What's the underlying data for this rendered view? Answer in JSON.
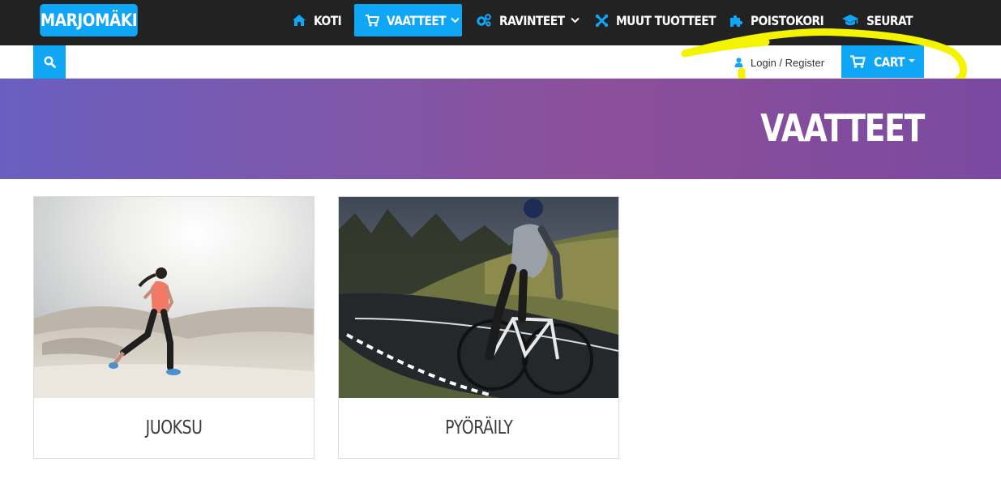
{
  "header": {
    "logo_text": "MARJOMÄKI",
    "nav": [
      {
        "label": "KOTI",
        "icon": "home-icon",
        "active": false
      },
      {
        "label": "VAATTEET",
        "icon": "cart-icon",
        "active": true,
        "dropdown": true
      },
      {
        "label": "RAVINTEET",
        "icon": "gears-icon",
        "active": false,
        "dropdown": true
      },
      {
        "label": "MUUT TUOTTEET",
        "icon": "joomla-icon",
        "active": false
      },
      {
        "label": "POISTOKORI",
        "icon": "puzzle-icon",
        "active": false
      },
      {
        "label": "SEURAT",
        "icon": "graduation-cap-icon",
        "active": false
      }
    ]
  },
  "toolbar": {
    "search_icon": "search-icon",
    "login_label": "Login / Register",
    "cart_label": "CART"
  },
  "hero": {
    "title": "VAATTEET"
  },
  "categories": [
    {
      "label": "JUOKSU",
      "image": "runner-on-sand-dunes"
    },
    {
      "label": "PYÖRÄILY",
      "image": "cyclist-on-road"
    }
  ],
  "colors": {
    "accent": "#0fa6f5",
    "navbar": "#222222",
    "highlight": "#f4f400",
    "hero_start": "#6a5fc0",
    "hero_end": "#7a4aa0"
  }
}
